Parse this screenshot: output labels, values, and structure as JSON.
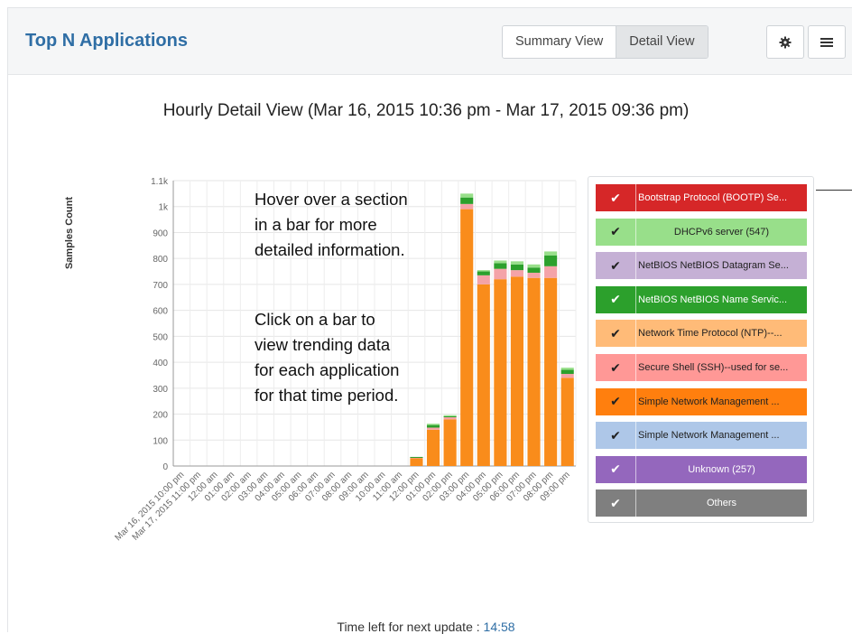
{
  "panel": {
    "title": "Top N Applications",
    "views": {
      "summary": "Summary View",
      "detail": "Detail View",
      "active": "detail"
    },
    "icons": {
      "settings": "gear-icon",
      "menu": "list-icon"
    }
  },
  "chart_data": {
    "type": "bar",
    "stacked": true,
    "title": "Hourly Detail View (Mar 16, 2015 10:36 pm - Mar 17, 2015 09:36 pm)",
    "ylabel": "Samples Count",
    "ylim": [
      0,
      1100
    ],
    "yticks": [
      "0",
      "100",
      "200",
      "300",
      "400",
      "500",
      "600",
      "700",
      "800",
      "900",
      "1k",
      "1.1k"
    ],
    "categories": [
      "Mar 16, 2015 10:00 pm",
      "Mar 17, 2015 11:00 pm",
      "12:00 am",
      "01:00 am",
      "02:00 am",
      "03:00 am",
      "04:00 am",
      "05:00 am",
      "06:00 am",
      "07:00 am",
      "08:00 am",
      "09:00 am",
      "10:00 am",
      "11:00 am",
      "12:00 pm",
      "01:00 pm",
      "02:00 pm",
      "03:00 pm",
      "04:00 pm",
      "05:00 pm",
      "06:00 pm",
      "07:00 pm",
      "08:00 pm",
      "09:00 pm"
    ],
    "series": [
      {
        "name": "Simple Network Management ...",
        "color": "#f98c1b",
        "values": [
          0,
          0,
          0,
          0,
          0,
          0,
          0,
          0,
          0,
          0,
          0,
          0,
          0,
          0,
          30,
          140,
          180,
          990,
          700,
          720,
          730,
          725,
          725,
          340
        ]
      },
      {
        "name": "Secure Shell (SSH)--used for se...",
        "color": "#f4a3a8",
        "values": [
          0,
          0,
          0,
          0,
          0,
          0,
          0,
          0,
          0,
          0,
          0,
          0,
          0,
          0,
          3,
          8,
          8,
          20,
          35,
          40,
          25,
          20,
          45,
          15
        ]
      },
      {
        "name": "NetBIOS NetBIOS Name Servic...",
        "color": "#2ca02c",
        "values": [
          0,
          0,
          0,
          0,
          0,
          0,
          0,
          0,
          0,
          0,
          0,
          0,
          0,
          0,
          2,
          10,
          4,
          25,
          15,
          22,
          22,
          20,
          42,
          16
        ]
      },
      {
        "name": "DHCPv6 server (547)",
        "color": "#98df8a",
        "values": [
          0,
          0,
          0,
          0,
          0,
          0,
          0,
          0,
          0,
          0,
          0,
          0,
          0,
          0,
          0,
          5,
          4,
          15,
          5,
          10,
          12,
          12,
          15,
          8
        ]
      }
    ],
    "annotations": [
      "Hover over a section",
      "in a bar for more",
      "detailed information.",
      "Click on a bar to",
      "view trending data",
      "for each application",
      "for that time period."
    ]
  },
  "legend": [
    {
      "label": "Bootstrap Protocol (BOOTP) Se...",
      "color": "#d62728",
      "text_color": "#ffffff"
    },
    {
      "label": "DHCPv6 server (547)",
      "color": "#98df8a",
      "text_color": "#222222"
    },
    {
      "label": "NetBIOS NetBIOS Datagram Se...",
      "color": "#c5b0d5",
      "text_color": "#222222"
    },
    {
      "label": "NetBIOS NetBIOS Name Servic...",
      "color": "#2ca02c",
      "text_color": "#ffffff"
    },
    {
      "label": "Network Time Protocol (NTP)--...",
      "color": "#ffbb78",
      "text_color": "#222222"
    },
    {
      "label": "Secure Shell (SSH)--used for se...",
      "color": "#ff9896",
      "text_color": "#222222"
    },
    {
      "label": "Simple Network Management ...",
      "color": "#ff7f0e",
      "text_color": "#222222"
    },
    {
      "label": "Simple Network Management ...",
      "color": "#aec7e8",
      "text_color": "#222222"
    },
    {
      "label": "Unknown (257)",
      "color": "#9467bd",
      "text_color": "#ffffff"
    },
    {
      "label": "Others",
      "color": "#7f7f7f",
      "text_color": "#ffffff"
    }
  ],
  "footer": {
    "label": "Time left for next update :",
    "timer": "14:58"
  }
}
